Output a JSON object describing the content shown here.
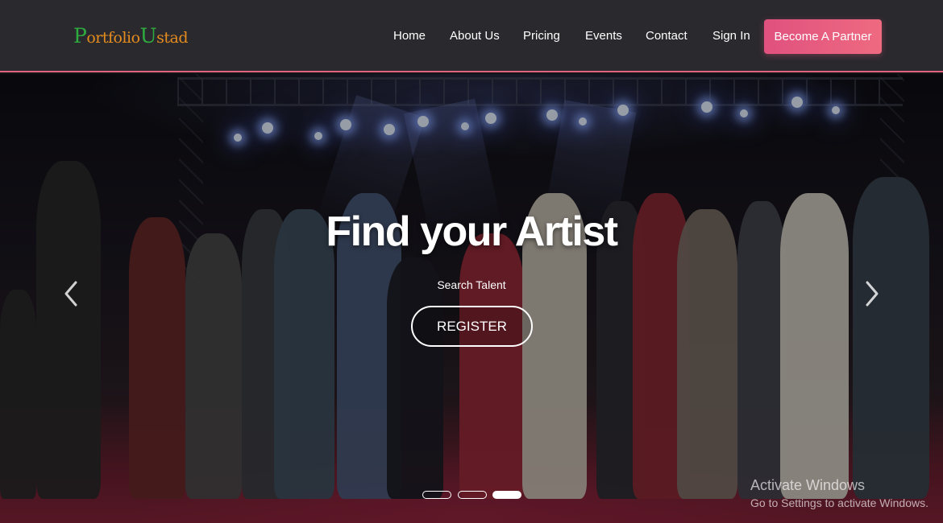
{
  "brand": {
    "logo_parts": [
      "P",
      "ortfolio",
      "U",
      "stad"
    ],
    "name": "PortfolioUstad",
    "green": "#2eab3f",
    "orange": "#e58c1f"
  },
  "nav": {
    "links": [
      "Home",
      "About Us",
      "Pricing",
      "Events",
      "Contact",
      "Sign In"
    ],
    "partner_button": "Become A Partner",
    "partner_color": "#e85a80",
    "border_color": "#e0637f"
  },
  "hero": {
    "title": "Find your Artist",
    "subtitle": "Search Talent",
    "register_button": "REGISTER",
    "prev_icon": "chevron-left-icon",
    "next_icon": "chevron-right-icon",
    "slides_total": 3,
    "active_slide": 3
  },
  "os_watermark": {
    "line1": "Activate Windows",
    "line2": "Go to Settings to activate Windows."
  }
}
